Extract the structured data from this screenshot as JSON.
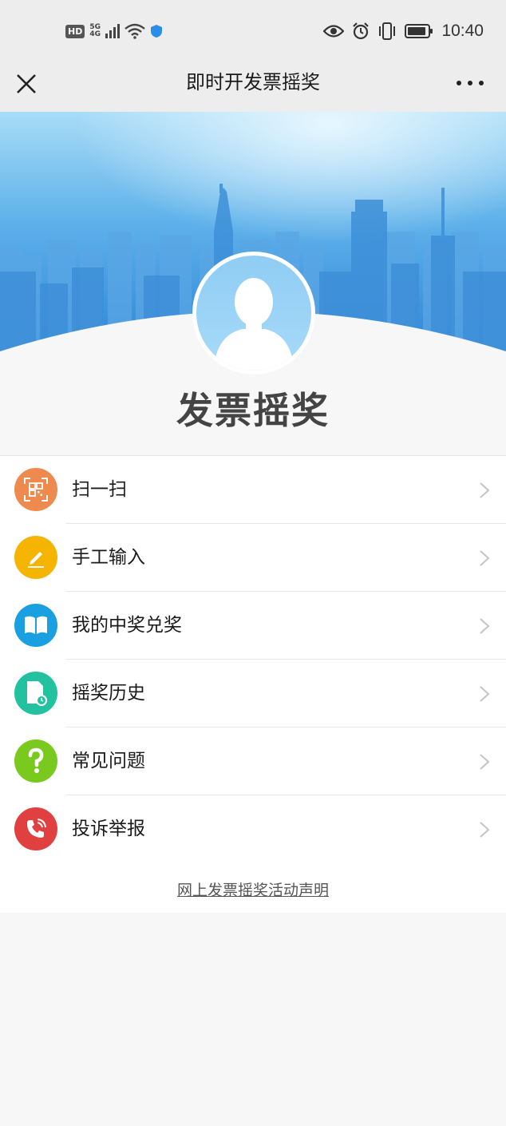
{
  "status_bar": {
    "hd": "HD",
    "network_top": "5G",
    "network_bottom": "4G",
    "time": "10:40",
    "icons": [
      "hd-icon",
      "signal-icon",
      "wifi-icon",
      "shield-icon",
      "eye-icon",
      "alarm-icon",
      "vibrate-icon",
      "battery-icon"
    ]
  },
  "nav": {
    "title": "即时开发票摇奖",
    "close_icon": "close-icon",
    "more_icon": "more-icon"
  },
  "hero": {
    "brand_title": "发票摇奖"
  },
  "menu": {
    "items": [
      {
        "label": "扫一扫",
        "icon": "qr-scan-icon",
        "color": "#ef8a4e"
      },
      {
        "label": "手工输入",
        "icon": "pencil-icon",
        "color": "#f5b400"
      },
      {
        "label": "我的中奖兑奖",
        "icon": "book-icon",
        "color": "#1aa0e0"
      },
      {
        "label": "摇奖历史",
        "icon": "document-clock-icon",
        "color": "#22c2a0"
      },
      {
        "label": "常见问题",
        "icon": "question-icon",
        "color": "#7ac91f"
      },
      {
        "label": "投诉举报",
        "icon": "phone-icon",
        "color": "#e04040"
      }
    ]
  },
  "footer": {
    "link": "网上发票摇奖活动声明"
  }
}
